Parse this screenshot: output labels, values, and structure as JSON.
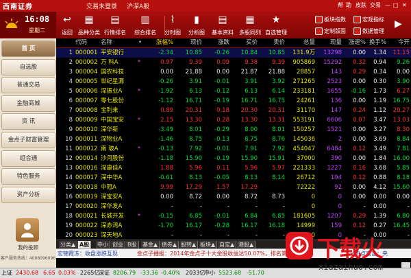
{
  "app": {
    "brand": "西南证券",
    "account_label": "交易未登录",
    "market_label": "沪深A股",
    "window_controls": [
      "帮",
      "助",
      "皮肤",
      "交易"
    ]
  },
  "clock": {
    "time": "16:08",
    "day": "星期二"
  },
  "toolbar": [
    {
      "label": "返回",
      "icon": "back-icon",
      "glyph": "↩"
    },
    {
      "label": "品种分类",
      "icon": "category-icon",
      "glyph": "▦"
    },
    {
      "label": "行情排名",
      "icon": "ranking-icon",
      "glyph": "▤"
    },
    {
      "label": "综合排名",
      "icon": "overall-rank-icon",
      "glyph": "▥"
    },
    {
      "label": "分时图",
      "icon": "intraday-chart-icon",
      "glyph": "⌇"
    },
    {
      "label": "分析图",
      "icon": "analysis-chart-icon",
      "glyph": "▮"
    },
    {
      "label": "基本资料",
      "icon": "profile-icon",
      "glyph": "▤"
    },
    {
      "label": "多股同列",
      "icon": "multi-stock-icon",
      "glyph": "▦"
    },
    {
      "label": "自选管理",
      "icon": "watchlist-icon",
      "glyph": "★"
    }
  ],
  "toolbar_right": [
    "板块指数",
    "宏观指标",
    "定制版面",
    "数据管理"
  ],
  "sidebar": {
    "items": [
      "首 页",
      "自选股",
      "普通交易",
      "金融商城",
      "资 讯",
      "金点子财富管理",
      "组合通",
      "特色服务",
      "资产分析"
    ],
    "active_index": 0,
    "avatar_label": "我的投顾",
    "hotline": "客户服务热线：4008096096"
  },
  "table": {
    "columns": [
      "代码",
      "名称",
      "•",
      "涨幅%",
      "现价",
      "涨跌",
      "买价",
      "卖价",
      "总量",
      "现量",
      "涨速%",
      "换手%",
      "今开"
    ],
    "selected_row": 0,
    "rows": [
      [
        "1",
        "000001",
        "平安银行",
        "",
        "-2.34",
        "10.85",
        "-0.26",
        "10.84",
        "10.85",
        "131.9万",
        "13298",
        "0.00",
        "1.34",
        "11.15"
      ],
      [
        "2",
        "000002",
        "万 科A",
        "*",
        "0.97",
        "9.39",
        "0.09",
        "9.38",
        "9.39",
        "905869",
        "15292",
        "0.32",
        "0.94",
        "9.26"
      ],
      [
        "3",
        "000004",
        "国农科技",
        "",
        "0.00",
        "21.88",
        "0.00",
        "21.87",
        "21.88",
        "28857",
        "143",
        "0.29",
        "0.34",
        "0.00"
      ],
      [
        "4",
        "000005",
        "世纪星源",
        "",
        "-0.26",
        "3.91",
        "-0.01",
        "3.91",
        "3.92",
        "271265",
        "2523",
        "0.00",
        "0.30",
        "3.90"
      ],
      [
        "5",
        "000006",
        "深振业A",
        "*",
        "-1.92",
        "6.13",
        "-0.12",
        "6.13",
        "6.14",
        "233181",
        "1655",
        "-0.16",
        "1.73",
        "6.27"
      ],
      [
        "6",
        "000007",
        "零七股份",
        "",
        "-1.12",
        "16.71",
        "-0.19",
        "16.71",
        "16.75",
        "24261",
        "136",
        "0.00",
        "1.19",
        "16.75"
      ],
      [
        "7",
        "000008",
        "宝利来",
        "",
        "0.89",
        "20.31",
        "0.18",
        "20.30",
        "20.31",
        "31170",
        "147",
        "0.24",
        "1.12",
        "20.27"
      ],
      [
        "8",
        "000009",
        "中国宝安",
        "*",
        "2.15",
        "13.30",
        "0.28",
        "13.30",
        "13.31",
        "553191",
        "6606",
        "0.07",
        "3.47",
        "13.03"
      ],
      [
        "9",
        "000010",
        "深华新",
        "",
        "-3.49",
        "8.01",
        "-0.29",
        "8.00",
        "8.01",
        "150257",
        "1521",
        "0.00",
        "3.27",
        "8.30"
      ],
      [
        "10",
        "000011",
        "深物业A",
        "",
        "-1.46",
        "8.75",
        "-0.13",
        "8.75",
        "8.76",
        "145036",
        "2",
        "0.00",
        "3.69",
        "8.84"
      ],
      [
        "11",
        "000012",
        "南 玻A",
        "*",
        "-0.13",
        "7.92",
        "-0.01",
        "7.91",
        "7.92",
        "454047",
        "6484",
        "0.12",
        "3.49",
        "7.81"
      ],
      [
        "12",
        "000014",
        "沙河股份",
        "",
        "-1.18",
        "15.90",
        "-0.19",
        "15.90",
        "15.91",
        "37000",
        "390",
        "0.00",
        "1.84",
        "16.00"
      ],
      [
        "13",
        "000016",
        "深康佳A",
        "",
        "1.88",
        "5.96",
        "0.11",
        "5.96",
        "5.97",
        "221333",
        "1227",
        "0.16",
        "3.68",
        "5.85"
      ],
      [
        "14",
        "000017",
        "深中华A",
        "",
        "-0.61",
        "8.13",
        "-0.05",
        "8.13",
        "8.14",
        "26712",
        "194",
        "0.12",
        "0.88",
        "8.18"
      ],
      [
        "15",
        "000018",
        "中冠A",
        "",
        "9.99",
        "17.29",
        "1.57",
        "17.29",
        "",
        "72222",
        "92",
        "0.00",
        "4.12",
        "15.60"
      ],
      [
        "16",
        "000019",
        "深宝安A",
        "",
        "0.00",
        "8.72",
        "0.00",
        "8.72",
        "8.73",
        "0",
        "0",
        "0.00",
        "0.00",
        "0.00"
      ],
      [
        "17",
        "000020",
        "深华发A",
        "",
        "-",
        "-",
        "-",
        "-",
        "-",
        "0",
        "0",
        "-",
        "0.00",
        "-"
      ],
      [
        "18",
        "000021",
        "长城开发",
        "*",
        "-0.15",
        "6.85",
        "-0.01",
        "6.84",
        "6.85",
        "181605",
        "1207",
        "0.29",
        "1.39",
        "6.80"
      ],
      [
        "19",
        "000022",
        "深赤湾A",
        "",
        "-1.70",
        "16.17",
        "-0.28",
        "16.17",
        "16.18",
        "14999",
        "159",
        "0.12",
        "0.27",
        "16.45"
      ],
      [
        "20",
        "000023",
        "深天地A",
        "",
        "-",
        "-",
        "-",
        "-",
        "-",
        "0",
        "0",
        "-",
        "0.00",
        "-"
      ]
    ]
  },
  "tabs": {
    "items": [
      "分类▲",
      "A股",
      "中小",
      "创业",
      "B股",
      "基金▲",
      "债券▲",
      "股转▲",
      "板块▲",
      "自定▲",
      "港股▲"
    ],
    "active_index": 1
  },
  "ticker": {
    "left": "宏锦霞冻：收盘涨跌互现",
    "middle": "金点子播报：2014年金点子十大金股收益达50.07%，排名第一",
    "right": "*热点直击：央"
  },
  "status": {
    "sh_label": "上证",
    "sh_value": "2430.68",
    "sh_change": "6.65",
    "sh_pct": "0.03%",
    "sh_amount": "2265亿",
    "sz_label": "深证",
    "sz_value": "8206.79",
    "sz_change": "-33.36",
    "sz_pct": "-0.40%",
    "sz_amount": "2033亿",
    "sme_label": "中小",
    "sme_value": "5523.68",
    "sme_change": "-51.70"
  },
  "watermark": {
    "text": "下载火",
    "url": "xiazaihuo.com"
  },
  "colors": {
    "red_up": "#ff3232",
    "green_down": "#00e03a",
    "code_yellow": "#e8e800",
    "brand_red": "#b5100e"
  }
}
